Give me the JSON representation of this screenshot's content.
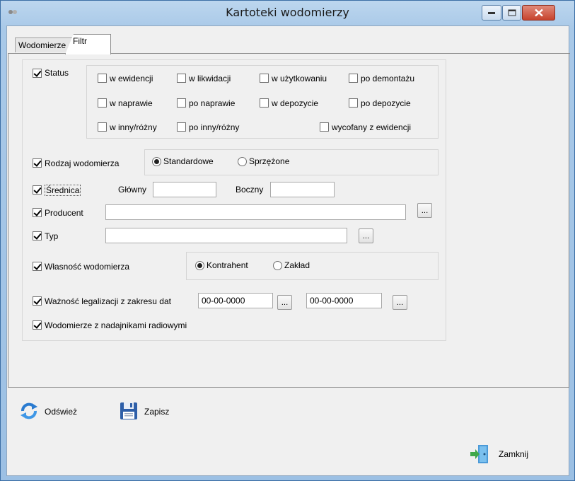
{
  "window": {
    "title": "Kartoteki wodomierzy"
  },
  "tabs": [
    {
      "label": "Wodomierze"
    },
    {
      "label": "Filtr"
    }
  ],
  "status": {
    "label": "Status",
    "checked": true,
    "options": [
      {
        "label": "w ewidencji",
        "checked": false
      },
      {
        "label": "w likwidacji",
        "checked": false
      },
      {
        "label": "w użytkowaniu",
        "checked": false
      },
      {
        "label": "po demontażu",
        "checked": false
      },
      {
        "label": "w naprawie",
        "checked": false
      },
      {
        "label": "po naprawie",
        "checked": false
      },
      {
        "label": "w depozycie",
        "checked": false
      },
      {
        "label": "po depozycie",
        "checked": false
      },
      {
        "label": "w inny/różny",
        "checked": false
      },
      {
        "label": "po inny/różny",
        "checked": false
      },
      {
        "label": "wycofany z ewidencji",
        "checked": false
      }
    ]
  },
  "rodzaj": {
    "label": "Rodzaj wodomierza",
    "checked": true,
    "options": [
      {
        "label": "Standardowe",
        "selected": true
      },
      {
        "label": "Sprzężone",
        "selected": false
      }
    ]
  },
  "srednica": {
    "label": "Średnica",
    "checked": true,
    "glowny_label": "Główny",
    "glowny_value": "",
    "boczny_label": "Boczny",
    "boczny_value": ""
  },
  "producent": {
    "label": "Producent",
    "checked": true,
    "value": "",
    "button": "..."
  },
  "typ": {
    "label": "Typ",
    "checked": true,
    "value": "",
    "button": "..."
  },
  "wlasnosc": {
    "label": "Własność wodomierza",
    "checked": true,
    "options": [
      {
        "label": "Kontrahent",
        "selected": true
      },
      {
        "label": "Zakład",
        "selected": false
      }
    ]
  },
  "legalizacja": {
    "label": "Ważność legalizacji z zakresu dat",
    "checked": true,
    "date_from": "00-00-0000",
    "date_to": "00-00-0000",
    "button": "..."
  },
  "radio_meters": {
    "label": "Wodomierze z nadajnikami radiowymi",
    "checked": true
  },
  "toolbar": {
    "refresh_label": "Odśwież",
    "save_label": "Zapisz",
    "close_label": "Zamknij"
  },
  "colors": {
    "titlebar": "#a9c9e8",
    "panel": "#f0f0f0",
    "close_button": "#c7432d"
  },
  "icons": {
    "refresh": "refresh-icon",
    "save": "floppy-disk-icon",
    "close": "exit-door-icon"
  }
}
